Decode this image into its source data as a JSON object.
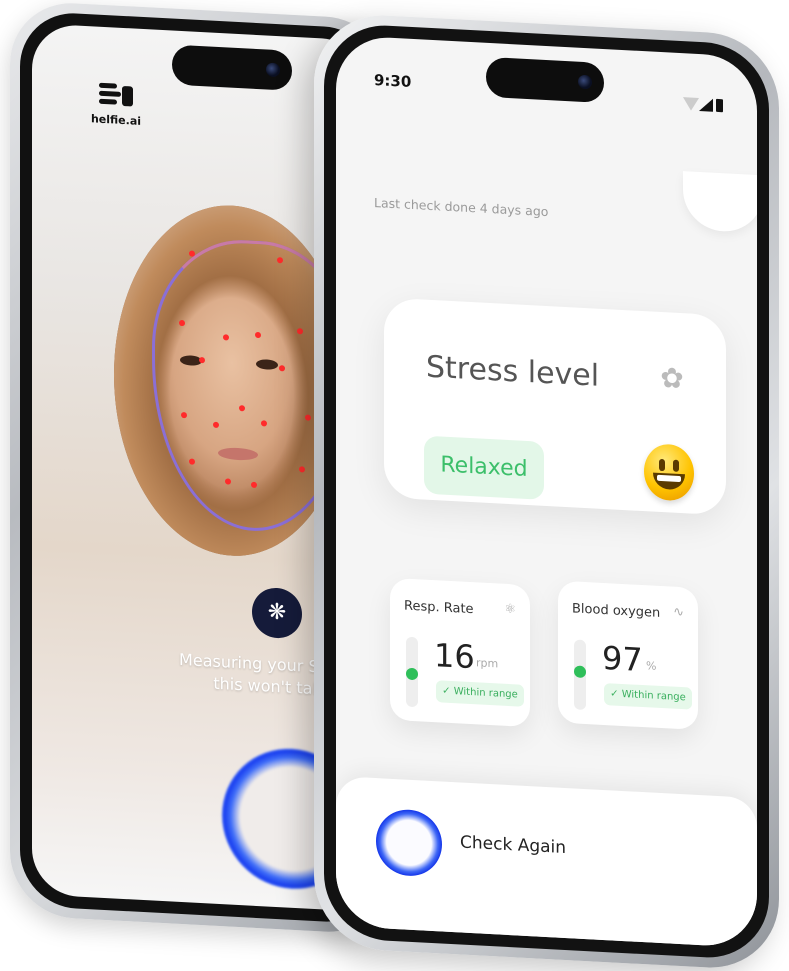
{
  "left_screen": {
    "brand": "helfie.ai",
    "measuring_line1": "Measuring your Stress Level",
    "measuring_line2": "this won't take long"
  },
  "right_screen": {
    "status_time": "9:30",
    "last_check": "Last check done 4 days ago",
    "stress_card": {
      "title": "Stress level",
      "status": "Relaxed",
      "status_color": "#3cbf6a",
      "emoji": "smiling-face"
    },
    "metrics": [
      {
        "label": "Resp. Rate",
        "value": "16",
        "unit": "rpm",
        "range": "Within range",
        "level": 0.55
      },
      {
        "label": "Blood oxygen",
        "value": "97",
        "unit": "%",
        "range": "Within range",
        "level": 0.45
      }
    ],
    "check_again_label": "Check Again"
  },
  "colors": {
    "accent_blue": "#1a3ff0",
    "ok_green": "#2fbf5a",
    "landmark_red": "#ff2b2b",
    "outline_purple": "#8b6fd6"
  }
}
